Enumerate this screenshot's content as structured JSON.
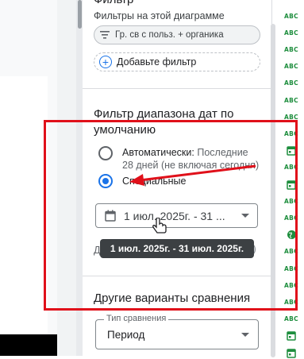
{
  "panel": {
    "section_header_partial": "Фильтр",
    "filters_on_chart_label": "Фильтры на этой диаграмме",
    "active_filter_chip": "Гр. св с польз. + органика",
    "add_filter_label": "Добавьте фильтр",
    "date_filter_title_line1": "Фильтр диапазона дат по",
    "date_filter_title_line2": "умолчанию",
    "radio_auto_label": "Автоматически:",
    "radio_auto_hint_line1": "Последние",
    "radio_auto_hint_line2": "28 дней (не включая сегодня)",
    "radio_custom_label": "Специальные",
    "date_range_value": "1 июл. 2025г. - 31 ...",
    "date_range_tooltip": "1 июл. 2025г. - 31 июл. 2025г.",
    "hidden_row_label_partial": "Д",
    "compare_title": "Другие варианты сравнения",
    "compare_type_label": "Тип сравнения",
    "compare_type_value": "Период"
  },
  "field_list": {
    "types": [
      "ABC",
      "ABC",
      "ABC",
      "ABC",
      "ABC",
      "ABC",
      "ABC",
      "ABC",
      "calendar",
      "ABC",
      "calendar",
      "ABC",
      "ABC",
      "globe",
      "ABC",
      "ABC",
      "ABC",
      "ABC",
      "ABC",
      "calendar",
      "calendar"
    ]
  },
  "colors": {
    "accent": "#1a73e8",
    "annotation_red": "#e0101a",
    "field_type_green": "#1e8e3e"
  }
}
